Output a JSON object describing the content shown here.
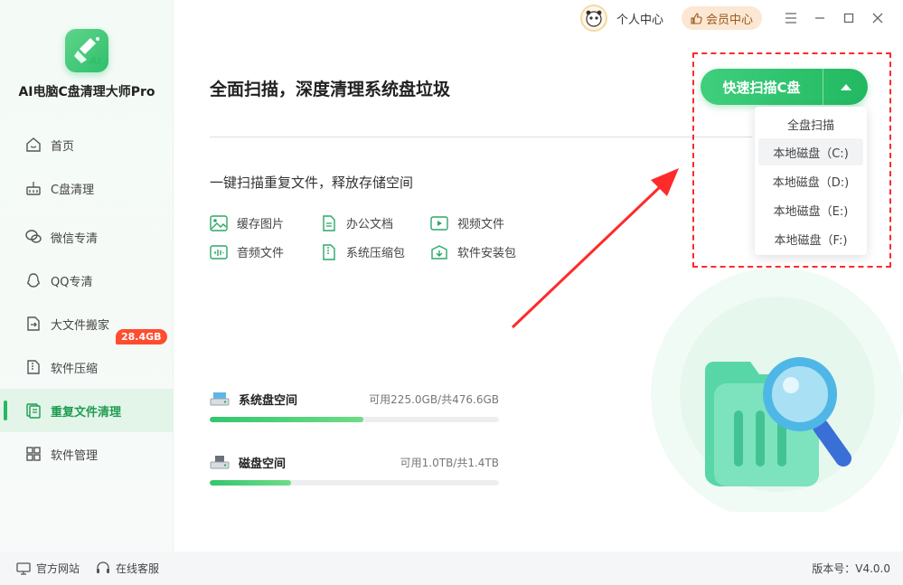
{
  "app": {
    "name": "AI电脑C盘清理大师Pro"
  },
  "sidebar": {
    "items": [
      {
        "label": "首页",
        "icon": "home-icon"
      },
      {
        "label": "C盘清理",
        "icon": "broom-icon"
      },
      {
        "label": "微信专清",
        "icon": "wechat-icon"
      },
      {
        "label": "QQ专清",
        "icon": "qq-icon"
      },
      {
        "label": "大文件搬家",
        "icon": "file-move-icon"
      },
      {
        "label": "软件压缩",
        "icon": "zip-icon",
        "badge": "28.4GB"
      },
      {
        "label": "重复文件清理",
        "icon": "duplicate-file-icon",
        "active": true
      },
      {
        "label": "软件管理",
        "icon": "apps-icon"
      }
    ]
  },
  "topbar": {
    "user_center": "个人中心",
    "vip": "会员中心"
  },
  "main": {
    "title": "全面扫描，深度清理系统盘垃圾",
    "subtitle": "一键扫描重复文件，释放存储空间",
    "file_types": [
      {
        "label": "缓存图片",
        "icon": "image-icon"
      },
      {
        "label": "办公文档",
        "icon": "document-icon"
      },
      {
        "label": "视频文件",
        "icon": "video-icon"
      },
      {
        "label": "音频文件",
        "icon": "audio-icon"
      },
      {
        "label": "系统压缩包",
        "icon": "archive-icon"
      },
      {
        "label": "软件安装包",
        "icon": "installer-icon"
      }
    ],
    "disks": [
      {
        "name": "系统盘空间",
        "info": "可用225.0GB/共476.6GB",
        "used_fraction": 0.53
      },
      {
        "name": "磁盘空间",
        "info": "可用1.0TB/共1.4TB",
        "used_fraction": 0.28
      }
    ]
  },
  "scan": {
    "button_label": "快速扫描C盘",
    "options": [
      "全盘扫描",
      "本地磁盘（C:)",
      "本地磁盘（D:)",
      "本地磁盘（E:)",
      "本地磁盘（F:)"
    ],
    "hovered_index": 1
  },
  "footer": {
    "website": "官方网站",
    "support": "在线客服",
    "version": "版本号：V4.0.0"
  },
  "colors": {
    "accent": "#27b862",
    "badge": "#ff4d2e",
    "annotation": "#ff2a2a"
  }
}
